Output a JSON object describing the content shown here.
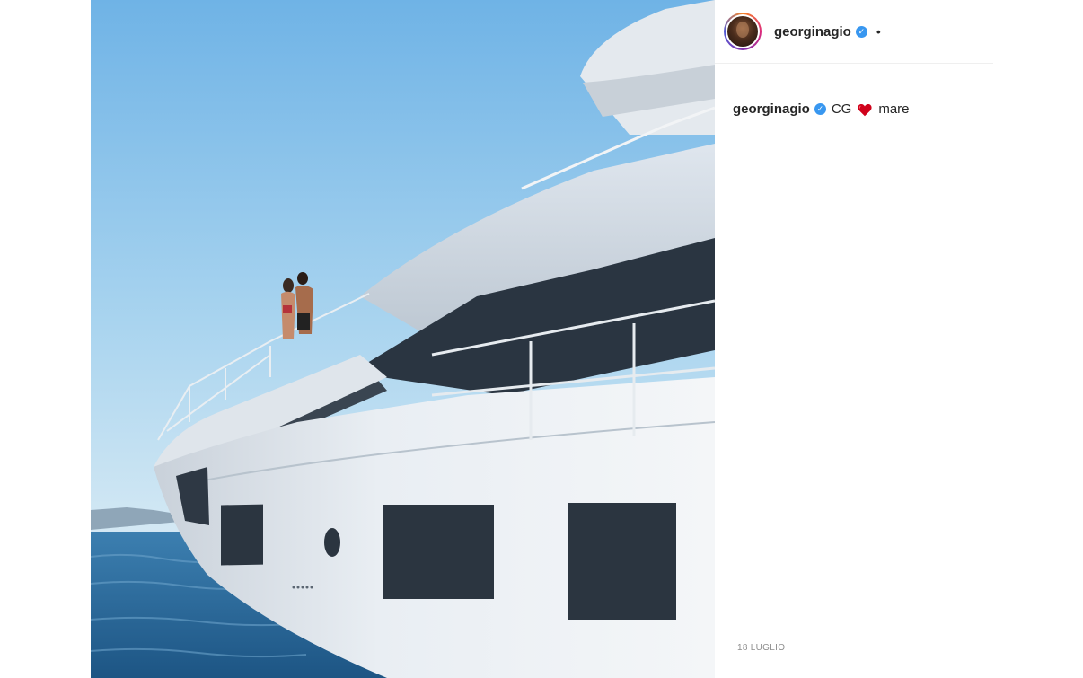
{
  "header": {
    "username": "georginagio",
    "verified_icon": "verified-badge-icon",
    "separator": "•"
  },
  "caption": {
    "username": "georginagio",
    "text_before": "CG",
    "emoji": "heart-icon",
    "text_after": "mare"
  },
  "timestamp": "18 LUGLIO",
  "colors": {
    "verified": "#3897f0",
    "heart": "#d0021b",
    "sky": "#a9d4ef",
    "sea": "#2f6f9e",
    "hull": "#eef1f4"
  }
}
